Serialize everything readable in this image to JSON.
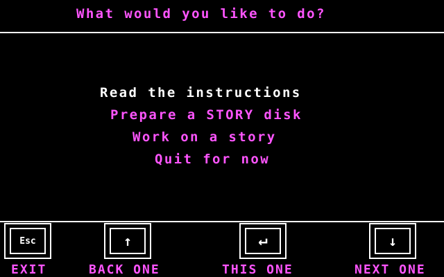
{
  "header": {
    "prompt": "What would you like to do?"
  },
  "menu": {
    "selected_index": 0,
    "items": [
      {
        "label": "Read the instructions"
      },
      {
        "label": "Prepare a STORY disk"
      },
      {
        "label": "Work on a story"
      },
      {
        "label": "Quit for now"
      }
    ]
  },
  "footer": {
    "keys": [
      {
        "key": "Esc",
        "icon": "esc-key-icon",
        "label": "EXIT"
      },
      {
        "key": "↑",
        "icon": "up-arrow-key-icon",
        "label": "BACK ONE"
      },
      {
        "key": "↵",
        "icon": "enter-key-icon",
        "label": "THIS ONE"
      },
      {
        "key": "↓",
        "icon": "down-arrow-key-icon",
        "label": "NEXT ONE"
      }
    ]
  },
  "colors": {
    "background": "#000000",
    "accent": "#ff55ff",
    "highlight": "#ffffff"
  }
}
